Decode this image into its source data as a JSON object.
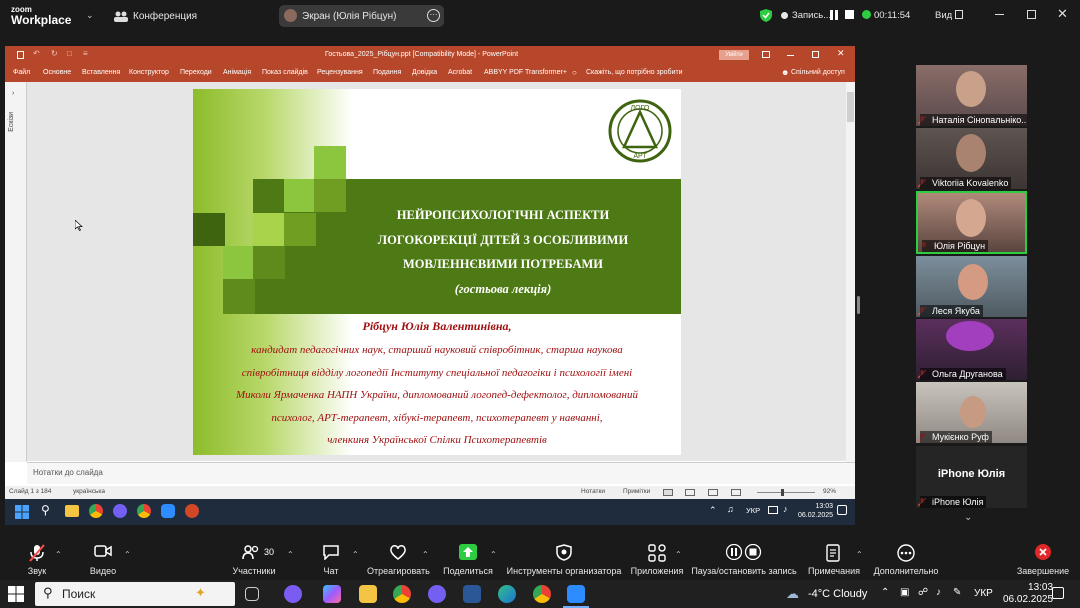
{
  "zoom": {
    "logo_top": "zoom",
    "logo_bottom": "Workplace",
    "meeting_label": "Конференция",
    "share_label": "Экран (Юлія Рібцун)",
    "record_label": "Запись...",
    "timer": "00:11:54",
    "view_label": "Вид"
  },
  "ppt": {
    "doc_title": "Гостьова_2025_Рібцун.ppt  [Compatibility Mode]  -  PowerPoint",
    "signin": "Увійти",
    "tabs": [
      "Файл",
      "Основне",
      "Вставлення",
      "Конструктор",
      "Переходи",
      "Анімація",
      "Показ слайдів",
      "Рецензування",
      "Подання",
      "Довідка",
      "Acrobat",
      "ABBYY PDF Transformer+"
    ],
    "tell_me": "Скажіть, що потрібно зробити",
    "share": "Спільний доступ",
    "side_label": "Ескізи",
    "notes_placeholder": "Нотатки до слайда",
    "status_slide": "Слайд 1 з 184",
    "status_lang": "українська",
    "status_notes": "Нотатки",
    "status_comments": "Примітки",
    "zoom_pct": "92%"
  },
  "slide": {
    "logo_top": "ЛОГО",
    "logo_bottom": "АРТ",
    "title_lines": [
      "НЕЙРОПСИХОЛОГІЧНІ АСПЕКТИ",
      "ЛОГОКОРЕКЦІЇ ДІТЕЙ З ОСОБЛИВИМИ",
      "МОВЛЕННЄВИМИ ПОТРЕБАМИ"
    ],
    "subtitle": "(гостьова лекція)",
    "author": "Рібцун Юлія Валентинівна,",
    "bio_lines": [
      "кандидат педагогічних наук, старший науковий співробітник, старша наукова",
      "співробітниця відділу логопедії  Інституту спеціальної педагогіки і психології імені",
      "Миколи Ярмаченка НАПН України, дипломований логопед-дефектолог, дипломований",
      "психолог, АРТ-терапевт, хібукі-терапевт, психотерапевт у навчанні,",
      "членкиня Української Спілки Психотерапевтів"
    ]
  },
  "inner_taskbar": {
    "lang": "УКР",
    "time": "13:03",
    "date": "06.02.2025"
  },
  "participants": [
    {
      "name": "Наталія Сінопальніко..."
    },
    {
      "name": "Viktoriia Kovalenko"
    },
    {
      "name": "Юлія Рібцун"
    },
    {
      "name": "Леся Якуба"
    },
    {
      "name": "Ольга Друганова"
    },
    {
      "name": "Мукієнко Руф"
    },
    {
      "name": "iPhone Юлія",
      "center_label": "iPhone Юлія"
    }
  ],
  "toolbar": {
    "audio": "Звук",
    "video": "Видео",
    "participants_count": "30",
    "participants": "Участники",
    "chat": "Чат",
    "react": "Отреагировать",
    "share": "Поделиться",
    "host_tools": "Инструменты организатора",
    "apps": "Приложения",
    "pause_record": "Пауза/остановить запись",
    "notes": "Примечания",
    "more": "Дополнительно",
    "end": "Завершение"
  },
  "taskbar": {
    "search": "Поиск",
    "weather": "-4°C  Cloudy",
    "lang": "УКР",
    "time": "13:03",
    "date": "06.02.2025"
  },
  "colors": {
    "ppt_red": "#b7472a",
    "slide_green": "#4e7a16",
    "slide_title_text": "#ffffff",
    "author_red": "#a01010",
    "active_speaker": "#2ecc40"
  }
}
